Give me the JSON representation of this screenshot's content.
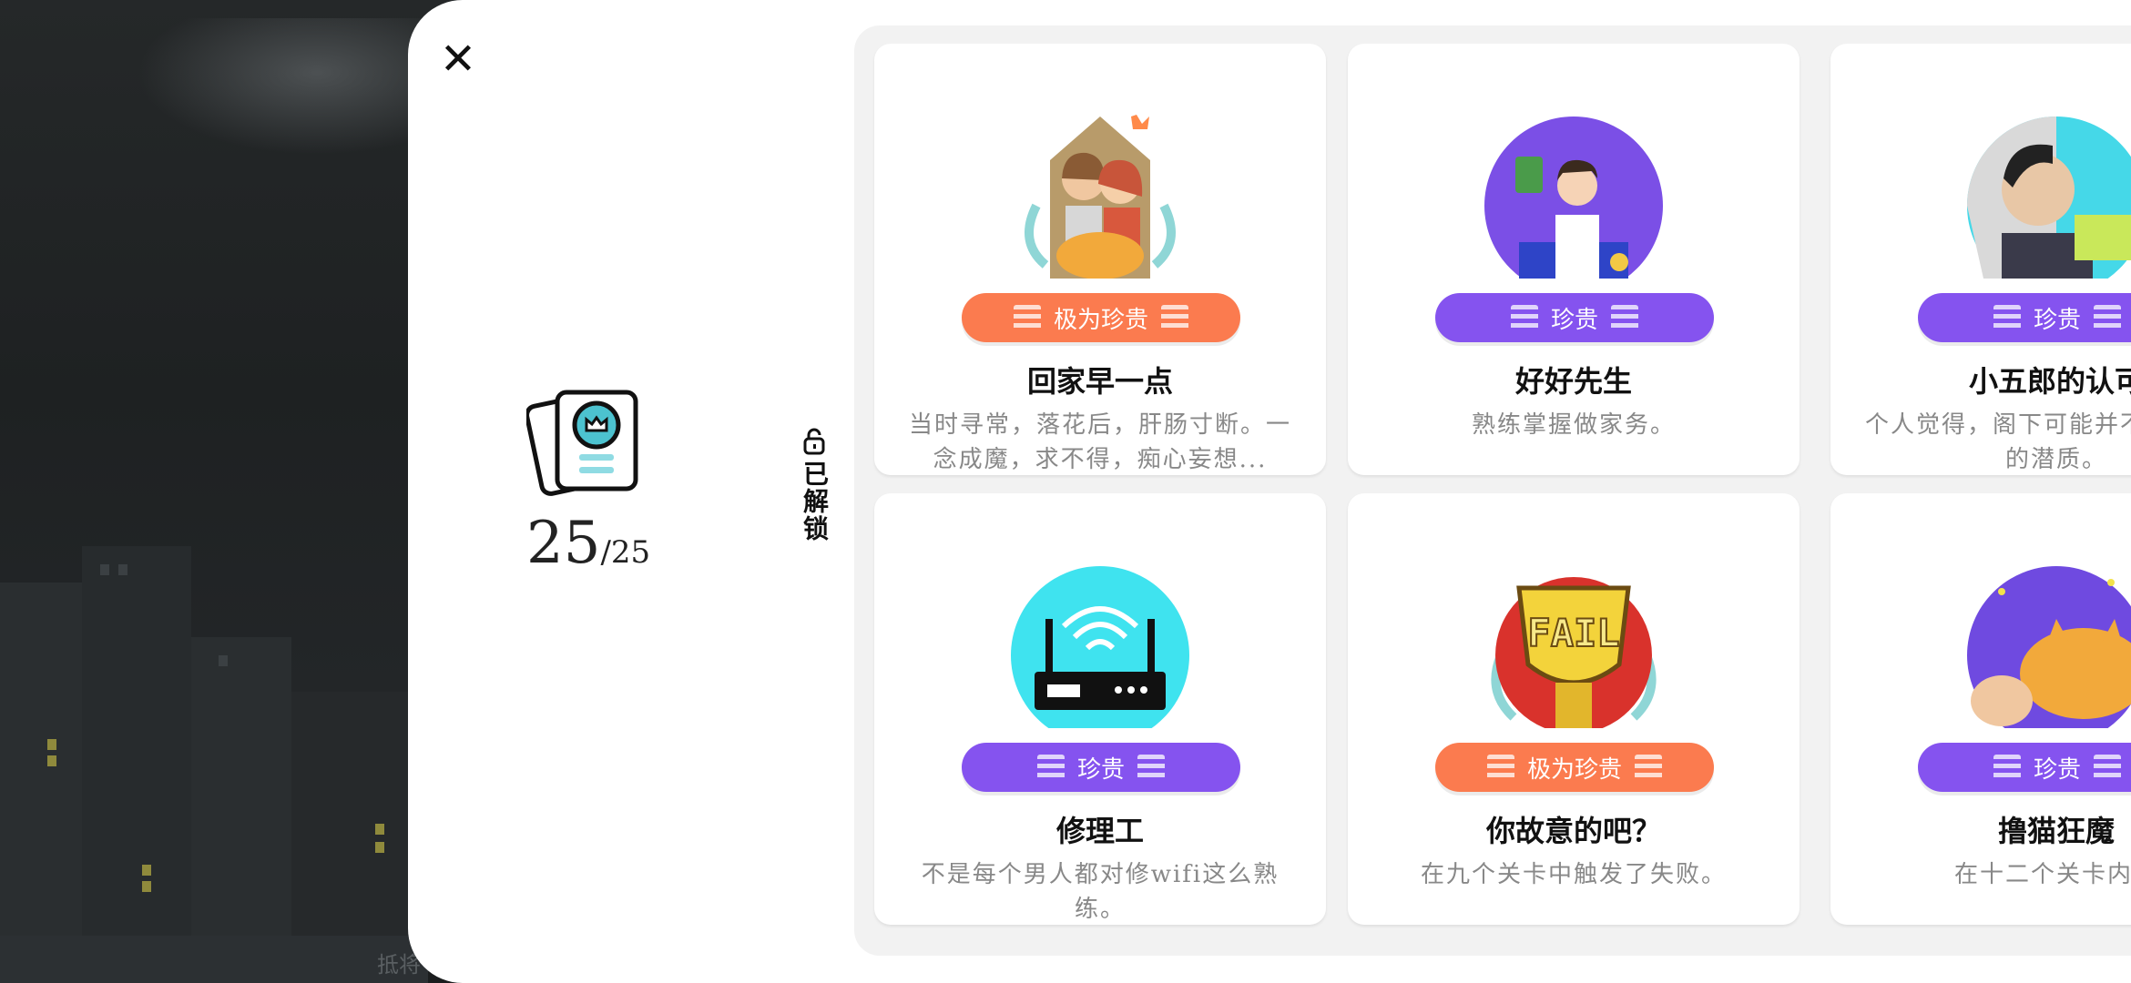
{
  "background": {
    "caption_fragment": "抵将"
  },
  "panel": {
    "close_icon": "close-icon",
    "summary": {
      "icon": "achievement-cards-icon",
      "unlocked_count": "25",
      "total": "/25"
    },
    "tab": {
      "icon": "unlock-icon",
      "label": "已解锁"
    }
  },
  "colors": {
    "rare_badge": "#8553ef",
    "very_rare_badge": "#fb7b4f",
    "panel": "#ffffff",
    "grid_bg": "#f2f2f2"
  },
  "achievements": [
    {
      "title": "回家早一点",
      "rarity": "极为珍贵",
      "description": "当时寻常，落花后，肝肠寸断。一念成魔，求不得，痴心妄想...",
      "art": "family-portrait-art"
    },
    {
      "title": "好好先生",
      "rarity": "珍贵",
      "description": "熟练掌握做家务。",
      "art": "house-husband-art"
    },
    {
      "title": "小五郎的认可",
      "rarity": "珍贵",
      "description": "个人觉得，阁下可能并不具备侦探的潜质。",
      "art": "detective-art"
    },
    {
      "title": "修理工",
      "rarity": "珍贵",
      "description": "不是每个男人都对修wifi这么熟练。",
      "art": "wifi-router-art"
    },
    {
      "title": "你故意的吧？",
      "rarity": "极为珍贵",
      "description": "在九个关卡中触发了失败。",
      "art": "fail-trophy-art"
    },
    {
      "title": "撸猫狂魔",
      "rarity": "珍贵",
      "description": "在十二个关卡内撸",
      "art": "cat-petting-art"
    }
  ]
}
